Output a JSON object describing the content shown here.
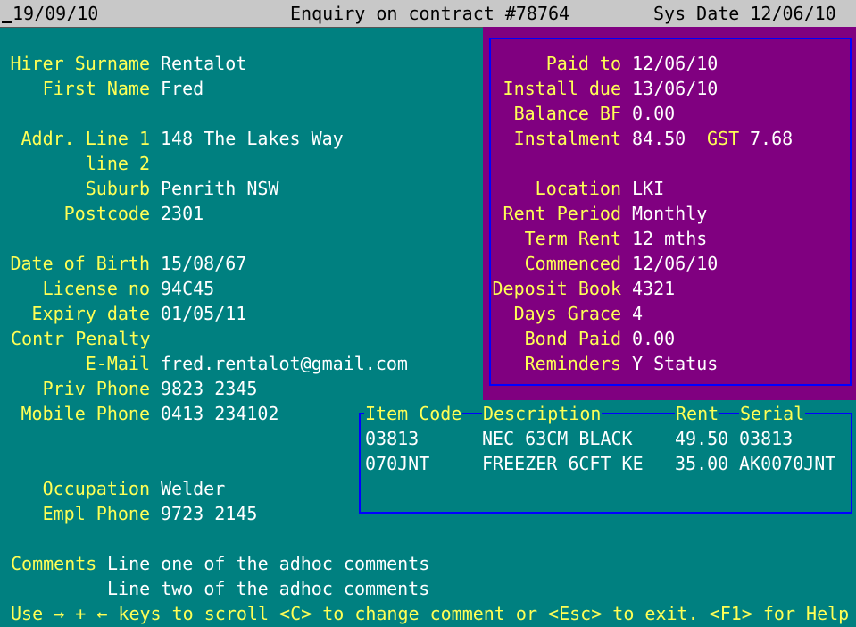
{
  "header": {
    "date": "19/09/10",
    "title": "Enquiry on contract #78764",
    "sys_date": "Sys Date 12/06/10"
  },
  "hirer": {
    "surname_label": "Hirer Surname",
    "surname": "Rentalot",
    "first_label": "First Name",
    "first": "Fred",
    "addr1_label": "Addr. Line 1",
    "addr1": "148 The Lakes Way",
    "addr2_label": "line 2",
    "addr2": "",
    "suburb_label": "Suburb",
    "suburb": "Penrith NSW",
    "postcode_label": "Postcode",
    "postcode": "2301",
    "dob_label": "Date of Birth",
    "dob": "15/08/67",
    "license_label": "License no",
    "license": "94C45",
    "expiry_label": "Expiry date",
    "expiry": "01/05/11",
    "penalty_label": "Contr Penalty",
    "penalty": "",
    "email_label": "E-Mail",
    "email": "fred.rentalot@gmail.com",
    "priv_phone_label": "Priv Phone",
    "priv_phone": "9823 2345",
    "mobile_label": "Mobile Phone",
    "mobile": "0413 234102",
    "occupation_label": "Occupation",
    "occupation": "Welder",
    "empl_phone_label": "Empl Phone",
    "empl_phone": "9723 2145"
  },
  "contract": {
    "paid_to_label": "Paid to",
    "paid_to": "12/06/10",
    "install_due_label": "Install due",
    "install_due": "13/06/10",
    "balance_label": "Balance BF",
    "balance": "0.00",
    "instalment_label": "Instalment",
    "instalment": "84.50",
    "gst_label": "GST",
    "gst": "7.68",
    "location_label": "Location",
    "location": "LKI",
    "rent_period_label": "Rent Period",
    "rent_period": "Monthly",
    "term_label": "Term Rent",
    "term": "12 mths",
    "commenced_label": "Commenced",
    "commenced": "12/06/10",
    "deposit_label": "Deposit Book",
    "deposit": "4321",
    "grace_label": "Days Grace",
    "grace": "4",
    "bond_label": "Bond Paid",
    "bond": "0.00",
    "reminders_label": "Reminders",
    "reminders": "Y Status"
  },
  "items": {
    "headers": [
      "Item Code",
      "Description",
      "Rent",
      "Serial"
    ],
    "rows": [
      [
        "03813",
        "NEC 63CM BLACK",
        "49.50",
        "03813"
      ],
      [
        "070JNT",
        "FREEZER 6CFT KE",
        "35.00",
        "AK0070JNT"
      ]
    ]
  },
  "comments": {
    "label": "Comments",
    "line1": "Line one of the adhoc comments",
    "line2": "Line two of the adhoc comments"
  },
  "footer": {
    "help": "Use → + ← keys to scroll <C> to change comment or <Esc> to exit. <F1> for Help"
  },
  "colors": {
    "background": "#008080",
    "panel": "#800080",
    "label": "#ffff55",
    "value": "#ffffff",
    "border": "#0000ff"
  }
}
